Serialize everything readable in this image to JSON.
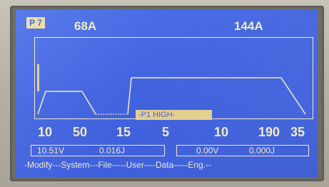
{
  "program": "P 7",
  "current_start": "68A",
  "current_main": "144A",
  "phase_label": "-P1 HIGH-",
  "params": [
    "10",
    "50",
    "15",
    "5",
    "10",
    "190",
    "35"
  ],
  "readout_left": {
    "voltage": "10.51V",
    "energy": "0.016J"
  },
  "readout_right": {
    "voltage": "0.00V",
    "energy": "0.000J"
  },
  "menu": "-Modify---System---File-----User----Data-----Eng.--",
  "colors": {
    "lcd_background": "#4367e0",
    "lcd_foreground": "#f1e9c4",
    "highlight": "#e3cf8d"
  }
}
